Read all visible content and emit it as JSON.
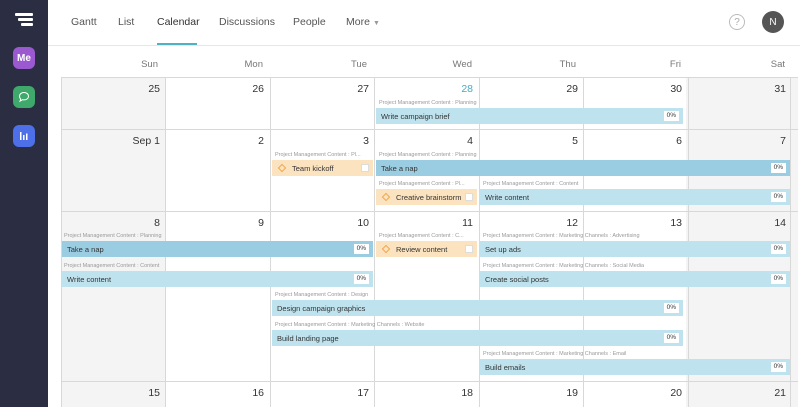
{
  "sidebar": {
    "me_label": "Me",
    "me_color": "#9b59d0",
    "chat_color": "#3fa96b",
    "reports_color": "#4d6fe8"
  },
  "nav": {
    "tabs": [
      "Gantt",
      "List",
      "Calendar",
      "Discussions",
      "People",
      "More"
    ],
    "active_tab": "Calendar",
    "help": "?",
    "avatar": "N"
  },
  "calendar": {
    "days_of_week": [
      "Sun",
      "Mon",
      "Tue",
      "Wed",
      "Thu",
      "Fri",
      "Sat"
    ],
    "weeks": [
      [
        "25",
        "26",
        "27",
        "28",
        "29",
        "30",
        "31"
      ],
      [
        "Sep 1",
        "2",
        "3",
        "4",
        "5",
        "6",
        "7"
      ],
      [
        "8",
        "9",
        "10",
        "11",
        "12",
        "13",
        "14"
      ],
      [
        "15",
        "16",
        "17",
        "18",
        "19",
        "20",
        "21"
      ]
    ],
    "today": "28",
    "tasks": [
      {
        "name": "Write campaign brief",
        "path": "Project Management Content : Planning",
        "pct": "0%",
        "type": "task"
      },
      {
        "name": "Team kickoff",
        "path": "Project Management Content : Pl...",
        "type": "milestone"
      },
      {
        "name": "Take a nap",
        "path": "Project Management Content : Planning",
        "pct": "0%",
        "type": "task"
      },
      {
        "name": "Creative brainstorm",
        "path": "Project Management Content : Pl...",
        "type": "milestone"
      },
      {
        "name": "Write content",
        "path": "Project Management Content : Content",
        "pct": "0%",
        "type": "task"
      },
      {
        "name": "Take a nap",
        "path": "Project Management Content : Planning",
        "pct": "0%",
        "type": "task"
      },
      {
        "name": "Review content",
        "path": "Project Management Content : C...",
        "type": "milestone"
      },
      {
        "name": "Set up ads",
        "path": "Project Management Content : Marketing Channels : Advertising",
        "pct": "0%",
        "type": "task"
      },
      {
        "name": "Write content",
        "path": "Project Management Content : Content",
        "pct": "0%",
        "type": "task"
      },
      {
        "name": "Create social posts",
        "path": "Project Management Content : Marketing Channels : Social Media",
        "pct": "0%",
        "type": "task"
      },
      {
        "name": "Design campaign graphics",
        "path": "Project Management Content : Design",
        "pct": "0%",
        "type": "task"
      },
      {
        "name": "Build landing page",
        "path": "Project Management Content : Marketing Channels : Website",
        "pct": "0%",
        "type": "task"
      },
      {
        "name": "Build emails",
        "path": "Project Management Content : Marketing Channels : Email",
        "pct": "0%",
        "type": "task"
      }
    ]
  }
}
